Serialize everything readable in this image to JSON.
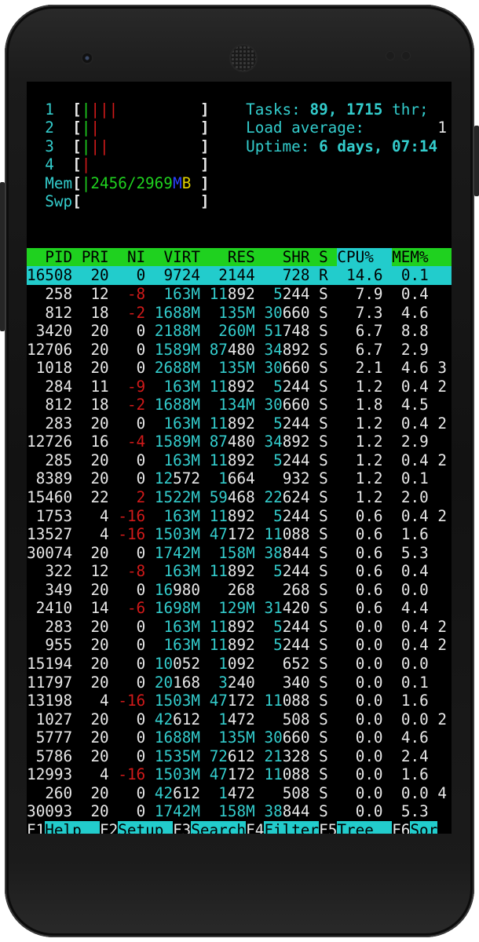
{
  "cpu_meters": [
    {
      "label": "1",
      "bars": [
        {
          "t": "|",
          "c": "green"
        },
        {
          "t": "|||",
          "c": "red"
        }
      ]
    },
    {
      "label": "2",
      "bars": [
        {
          "t": "|",
          "c": "green"
        },
        {
          "t": "|",
          "c": "red"
        }
      ]
    },
    {
      "label": "3",
      "bars": [
        {
          "t": "|",
          "c": "green"
        },
        {
          "t": "||",
          "c": "red"
        }
      ]
    },
    {
      "label": "4",
      "bars": [
        {
          "t": "|",
          "c": "red"
        }
      ]
    }
  ],
  "mem_meter": {
    "label": "Mem",
    "bar": "|",
    "value": "2456/2969",
    "unit_m": "M",
    "unit_b": "B"
  },
  "swp_meter": {
    "label": "Swp"
  },
  "summary": {
    "tasks_label": "Tasks: ",
    "tasks_value": "89, 1715",
    "tasks_suffix": " thr;",
    "load_label": "Load average:",
    "load_value": "1",
    "uptime_label": "Uptime: ",
    "uptime_value": "6 days, 07:14"
  },
  "columns": [
    "PID",
    "PRI",
    "NI",
    "VIRT",
    "RES",
    "SHR",
    "S",
    "CPU%",
    "MEM%"
  ],
  "processes": [
    {
      "pid": "16508",
      "pri": "20",
      "ni": "0",
      "virt": "9724",
      "res": "2144",
      "shr": "728",
      "s": "R",
      "cpu": "14.6",
      "mem": "0.1",
      "extra": ""
    },
    {
      "pid": "258",
      "pri": "12",
      "ni": "-8",
      "virt": "163M",
      "res": "11892",
      "shr": "5244",
      "s": "S",
      "cpu": "7.9",
      "mem": "0.4",
      "extra": ""
    },
    {
      "pid": "812",
      "pri": "18",
      "ni": "-2",
      "virt": "1688M",
      "res": "135M",
      "shr": "30660",
      "s": "S",
      "cpu": "7.3",
      "mem": "4.6",
      "extra": ""
    },
    {
      "pid": "3420",
      "pri": "20",
      "ni": "0",
      "virt": "2188M",
      "res": "260M",
      "shr": "51748",
      "s": "S",
      "cpu": "6.7",
      "mem": "8.8",
      "extra": ""
    },
    {
      "pid": "12706",
      "pri": "20",
      "ni": "0",
      "virt": "1589M",
      "res": "87480",
      "shr": "34892",
      "s": "S",
      "cpu": "6.7",
      "mem": "2.9",
      "extra": ""
    },
    {
      "pid": "1018",
      "pri": "20",
      "ni": "0",
      "virt": "2688M",
      "res": "135M",
      "shr": "30660",
      "s": "S",
      "cpu": "2.1",
      "mem": "4.6",
      "extra": "3"
    },
    {
      "pid": "284",
      "pri": "11",
      "ni": "-9",
      "virt": "163M",
      "res": "11892",
      "shr": "5244",
      "s": "S",
      "cpu": "1.2",
      "mem": "0.4",
      "extra": "2"
    },
    {
      "pid": "812",
      "pri": "18",
      "ni": "-2",
      "virt": "1688M",
      "res": "134M",
      "shr": "30660",
      "s": "S",
      "cpu": "1.8",
      "mem": "4.5",
      "extra": ""
    },
    {
      "pid": "283",
      "pri": "20",
      "ni": "0",
      "virt": "163M",
      "res": "11892",
      "shr": "5244",
      "s": "S",
      "cpu": "1.2",
      "mem": "0.4",
      "extra": "2"
    },
    {
      "pid": "12726",
      "pri": "16",
      "ni": "-4",
      "virt": "1589M",
      "res": "87480",
      "shr": "34892",
      "s": "S",
      "cpu": "1.2",
      "mem": "2.9",
      "extra": ""
    },
    {
      "pid": "285",
      "pri": "20",
      "ni": "0",
      "virt": "163M",
      "res": "11892",
      "shr": "5244",
      "s": "S",
      "cpu": "1.2",
      "mem": "0.4",
      "extra": "2"
    },
    {
      "pid": "8389",
      "pri": "20",
      "ni": "0",
      "virt": "12572",
      "res": "1664",
      "shr": "932",
      "s": "S",
      "cpu": "1.2",
      "mem": "0.1",
      "extra": ""
    },
    {
      "pid": "15460",
      "pri": "22",
      "ni": "2",
      "virt": "1522M",
      "res": "59468",
      "shr": "22624",
      "s": "S",
      "cpu": "1.2",
      "mem": "2.0",
      "extra": ""
    },
    {
      "pid": "1753",
      "pri": "4",
      "ni": "-16",
      "virt": "163M",
      "res": "11892",
      "shr": "5244",
      "s": "S",
      "cpu": "0.6",
      "mem": "0.4",
      "extra": "2"
    },
    {
      "pid": "13527",
      "pri": "4",
      "ni": "-16",
      "virt": "1503M",
      "res": "47172",
      "shr": "11088",
      "s": "S",
      "cpu": "0.6",
      "mem": "1.6",
      "extra": ""
    },
    {
      "pid": "30074",
      "pri": "20",
      "ni": "0",
      "virt": "1742M",
      "res": "158M",
      "shr": "38844",
      "s": "S",
      "cpu": "0.6",
      "mem": "5.3",
      "extra": ""
    },
    {
      "pid": "322",
      "pri": "12",
      "ni": "-8",
      "virt": "163M",
      "res": "11892",
      "shr": "5244",
      "s": "S",
      "cpu": "0.6",
      "mem": "0.4",
      "extra": ""
    },
    {
      "pid": "349",
      "pri": "20",
      "ni": "0",
      "virt": "16980",
      "res": "268",
      "shr": "268",
      "s": "S",
      "cpu": "0.6",
      "mem": "0.0",
      "extra": ""
    },
    {
      "pid": "2410",
      "pri": "14",
      "ni": "-6",
      "virt": "1698M",
      "res": "129M",
      "shr": "31420",
      "s": "S",
      "cpu": "0.6",
      "mem": "4.4",
      "extra": ""
    },
    {
      "pid": "283",
      "pri": "20",
      "ni": "0",
      "virt": "163M",
      "res": "11892",
      "shr": "5244",
      "s": "S",
      "cpu": "0.0",
      "mem": "0.4",
      "extra": "2"
    },
    {
      "pid": "955",
      "pri": "20",
      "ni": "0",
      "virt": "163M",
      "res": "11892",
      "shr": "5244",
      "s": "S",
      "cpu": "0.0",
      "mem": "0.4",
      "extra": "2"
    },
    {
      "pid": "15194",
      "pri": "20",
      "ni": "0",
      "virt": "10052",
      "res": "1092",
      "shr": "652",
      "s": "S",
      "cpu": "0.0",
      "mem": "0.0",
      "extra": ""
    },
    {
      "pid": "11797",
      "pri": "20",
      "ni": "0",
      "virt": "20168",
      "res": "3240",
      "shr": "340",
      "s": "S",
      "cpu": "0.0",
      "mem": "0.1",
      "extra": ""
    },
    {
      "pid": "13198",
      "pri": "4",
      "ni": "-16",
      "virt": "1503M",
      "res": "47172",
      "shr": "11088",
      "s": "S",
      "cpu": "0.0",
      "mem": "1.6",
      "extra": ""
    },
    {
      "pid": "1027",
      "pri": "20",
      "ni": "0",
      "virt": "42612",
      "res": "1472",
      "shr": "508",
      "s": "S",
      "cpu": "0.0",
      "mem": "0.0",
      "extra": "2"
    },
    {
      "pid": "5777",
      "pri": "20",
      "ni": "0",
      "virt": "1688M",
      "res": "135M",
      "shr": "30660",
      "s": "S",
      "cpu": "0.0",
      "mem": "4.6",
      "extra": ""
    },
    {
      "pid": "5786",
      "pri": "20",
      "ni": "0",
      "virt": "1535M",
      "res": "72612",
      "shr": "21328",
      "s": "S",
      "cpu": "0.0",
      "mem": "2.4",
      "extra": ""
    },
    {
      "pid": "12993",
      "pri": "4",
      "ni": "-16",
      "virt": "1503M",
      "res": "47172",
      "shr": "11088",
      "s": "S",
      "cpu": "0.0",
      "mem": "1.6",
      "extra": ""
    },
    {
      "pid": "260",
      "pri": "20",
      "ni": "0",
      "virt": "42612",
      "res": "1472",
      "shr": "508",
      "s": "S",
      "cpu": "0.0",
      "mem": "0.0",
      "extra": "4"
    },
    {
      "pid": "30093",
      "pri": "20",
      "ni": "0",
      "virt": "1742M",
      "res": "158M",
      "shr": "38844",
      "s": "S",
      "cpu": "0.0",
      "mem": "5.3",
      "extra": ""
    }
  ],
  "fkeys": [
    {
      "key": "F1",
      "label": "Help  "
    },
    {
      "key": "F2",
      "label": "Setup "
    },
    {
      "key": "F3",
      "label": "Search"
    },
    {
      "key": "F4",
      "label": "Filter"
    },
    {
      "key": "F5",
      "label": "Tree  "
    },
    {
      "key": "F6",
      "label": "Sor"
    }
  ],
  "colors": {
    "cyan": "#33cccc",
    "green": "#1fd11f",
    "red": "#d11a1a",
    "blue": "#2a40ff",
    "yellow": "#e0d000",
    "header_bg": "#1fd11f",
    "selected_bg": "#22cccc"
  }
}
